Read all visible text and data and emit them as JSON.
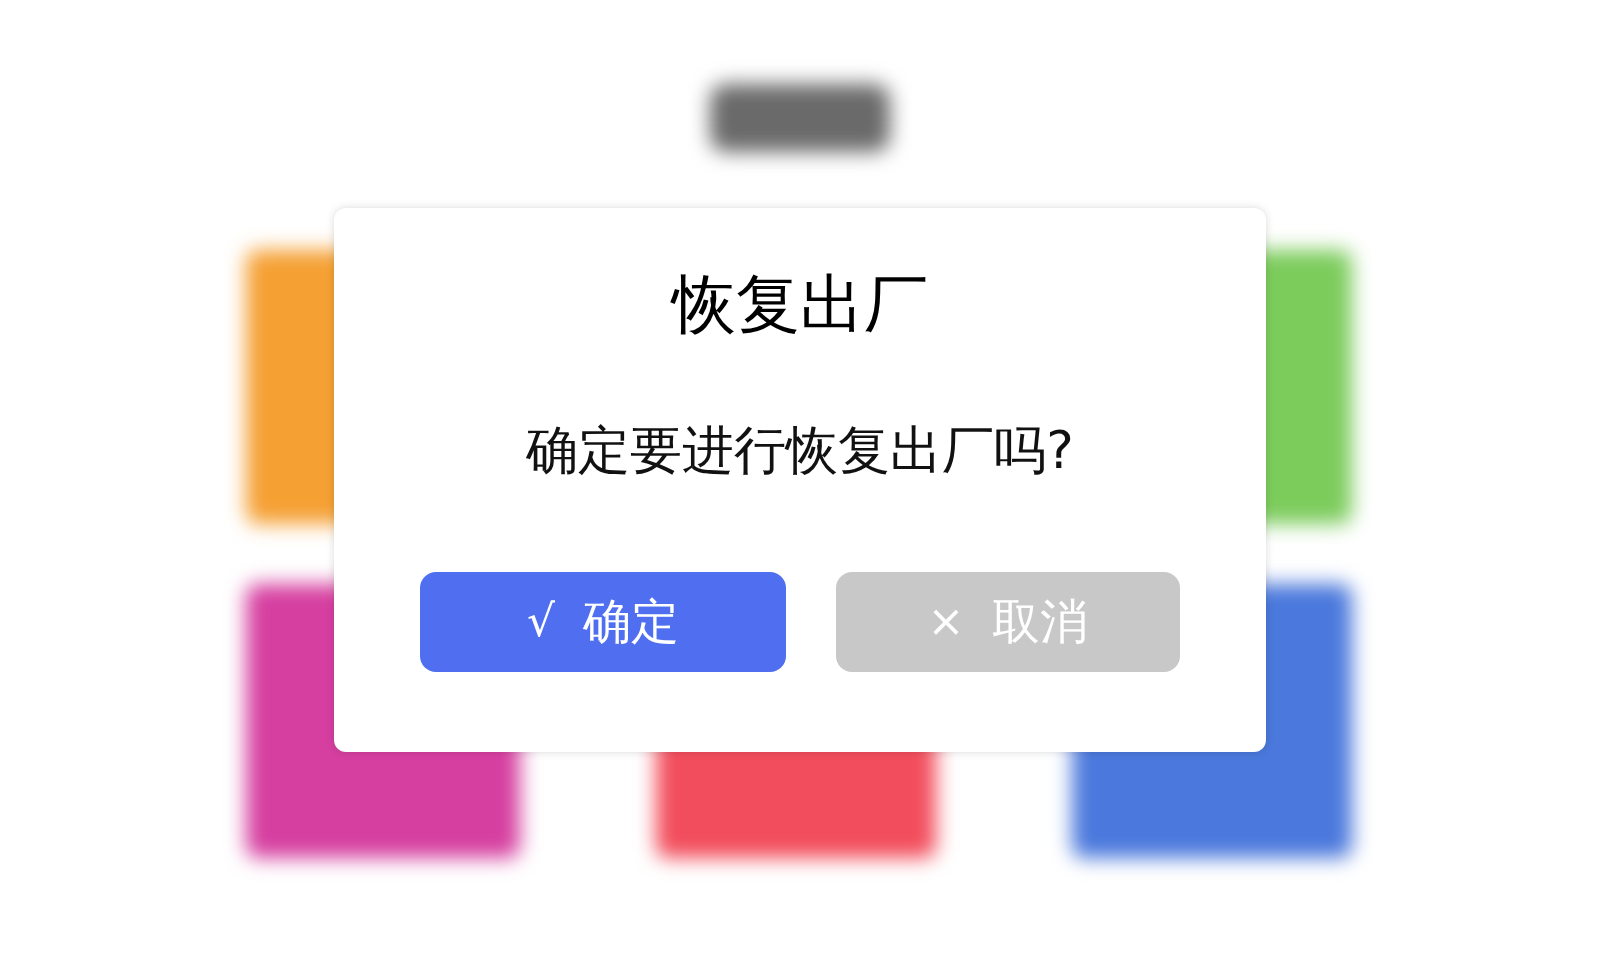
{
  "background": {
    "tiles": [
      {
        "color": "#f5a033"
      },
      {
        "color": "#7ccc5c"
      },
      {
        "color": "#d63fa0"
      },
      {
        "color": "#f24d5c"
      },
      {
        "color": "#4a78dc"
      }
    ]
  },
  "dialog": {
    "title": "恢复出厂",
    "message": "确定要进行恢复出厂吗?",
    "buttons": [
      {
        "kind": "primary",
        "icon": "√",
        "label": "确定"
      },
      {
        "kind": "secondary",
        "icon": "×",
        "label": "取消"
      }
    ]
  }
}
